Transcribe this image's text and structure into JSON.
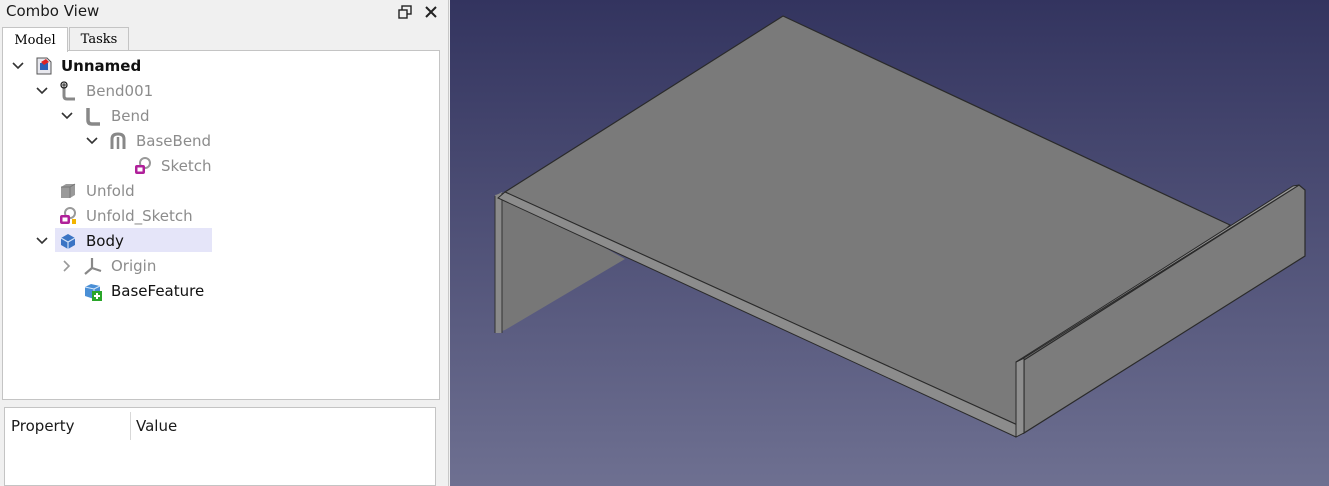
{
  "panel": {
    "title": "Combo View"
  },
  "tabs": [
    {
      "label": "Model"
    },
    {
      "label": "Tasks"
    }
  ],
  "tree": [
    {
      "label": "Unnamed",
      "icon": "document-icon",
      "expanded": true
    },
    {
      "label": "Bend001",
      "icon": "bend-icon",
      "expanded": true
    },
    {
      "label": "Bend",
      "icon": "bend-icon",
      "expanded": true
    },
    {
      "label": "BaseBend",
      "icon": "base-bend-icon",
      "expanded": true
    },
    {
      "label": "Sketch",
      "icon": "sketch-icon"
    },
    {
      "label": "Unfold",
      "icon": "solid-icon"
    },
    {
      "label": "Unfold_Sketch",
      "icon": "sketch-icon"
    },
    {
      "label": "Body",
      "icon": "body-icon",
      "expanded": true
    },
    {
      "label": "Origin",
      "icon": "origin-icon",
      "expanded": false
    },
    {
      "label": "BaseFeature",
      "icon": "base-feature-icon"
    }
  ],
  "properties": {
    "col_property": "Property",
    "col_value": "Value"
  },
  "colors": {
    "selection": "#e5e5f9",
    "gray_text": "#8c8c8c",
    "sketch": "#b0209a"
  }
}
